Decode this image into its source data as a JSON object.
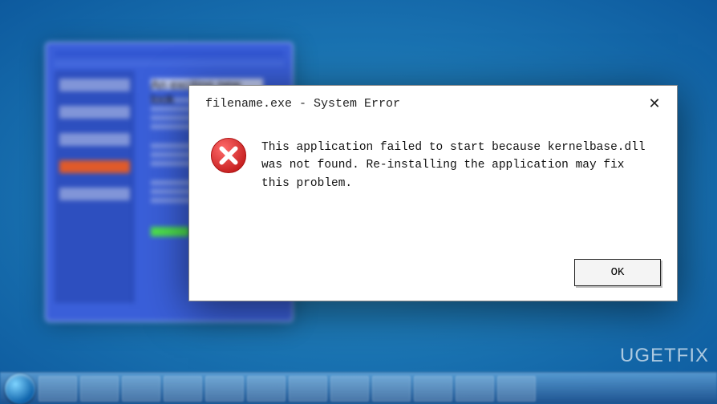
{
  "dialog": {
    "title": "filename.exe - System Error",
    "message": "This application failed to start because kernelbase.dll was not found. Re-installing the application may fix this problem.",
    "ok_label": "OK",
    "close_glyph": "✕",
    "icon_name": "error-icon"
  },
  "watermark": "UGETFIX",
  "taskbar": {
    "items_count": 12
  },
  "background_window": {
    "heading": "An exciting new look"
  }
}
